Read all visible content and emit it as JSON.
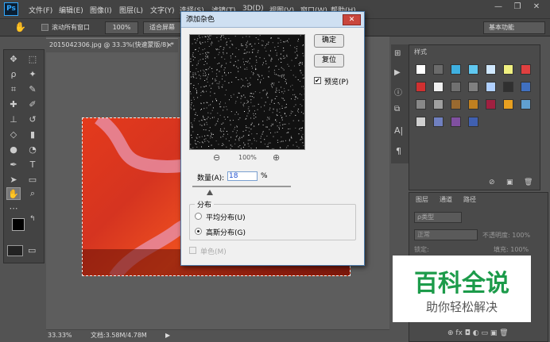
{
  "app": {
    "logo": "Ps"
  },
  "menu": [
    "文件(F)",
    "编辑(E)",
    "图像(I)",
    "图层(L)",
    "文字(Y)",
    "选择(S)",
    "滤镜(T)",
    "3D(D)",
    "视图(V)",
    "窗口(W)",
    "帮助(H)"
  ],
  "window_controls": {
    "minimize": "—",
    "restore": "❐",
    "close": "✕"
  },
  "options_bar": {
    "scroll_all_label": "滚动所有窗口",
    "zoom_100": "100%",
    "fit_screen": "适合屏幕",
    "workspace": "基本功能"
  },
  "document": {
    "tab_title": "2015042306.jpg @ 33.3%(快速蒙版/8) *",
    "tab_close": "×",
    "zoom": "33.33%",
    "doc_size": "文档:3.58M/4.78M"
  },
  "dialog": {
    "title": "添加杂色",
    "close": "✕",
    "ok": "确定",
    "reset": "复位",
    "preview_label": "预览(P)",
    "preview_checked": true,
    "zoom_out": "⊖",
    "zoom_level": "100%",
    "zoom_in": "⊕",
    "amount_label": "数量(A):",
    "amount_value": "18",
    "amount_unit": "%",
    "amount_fraction": 0.18,
    "distribution_label": "分布",
    "uniform_label": "平均分布(U)",
    "gaussian_label": "高斯分布(G)",
    "selected_distribution": "gaussian",
    "mono_label": "单色(M)",
    "mono_checked": false
  },
  "styles_panel": {
    "tab": "样式",
    "swatches": [
      "#ffffff",
      "#6b6b6b",
      "#3fb0e0",
      "#60c8f0",
      "#d0e8ff",
      "#f0f080",
      "#e04040",
      "#d03030",
      "#f0f0f0",
      "#707070",
      "#808080",
      "#b0d0ff",
      "#303030",
      "#4070c0",
      "#888888",
      "#a0a0a0",
      "#9a6a30",
      "#c08020",
      "#a02040",
      "#e8a020",
      "#60a0d0",
      "#d0d0d0",
      "#7080c0",
      "#8050a0",
      "#4060b0"
    ]
  },
  "layers_panel": {
    "tabs": [
      "图层",
      "通道",
      "路径"
    ],
    "filter": "ρ类型",
    "blend_mode": "正常",
    "opacity": "不透明度: 100%",
    "lock": "锁定:",
    "fill": "填充: 100%",
    "footer_icons": "⊕ fx ◘ ◐ ▭ ▣ 🗑"
  },
  "watermark": {
    "title": "百科全说",
    "subtitle": "助你轻松解决"
  },
  "colors": {
    "accent": "#31a8ff",
    "watermark_green": "#1c9b4a",
    "canvas_red": "#e43a1c"
  }
}
